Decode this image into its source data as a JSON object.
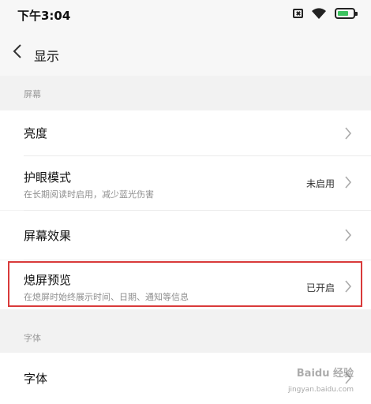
{
  "status_bar": {
    "time": "下午3:04",
    "icons": [
      "sim-off-icon",
      "wifi-icon",
      "battery-charging-icon"
    ],
    "battery_color": "#3cc35f"
  },
  "header": {
    "title": "显示",
    "back_icon": "chevron-left-icon"
  },
  "sections": {
    "screen": {
      "label": "屏幕",
      "items": [
        {
          "title": "亮度",
          "subtitle": "",
          "value": ""
        },
        {
          "title": "护眼模式",
          "subtitle": "在长期阅读时启用，减少蓝光伤害",
          "value": "未启用"
        },
        {
          "title": "屏幕效果",
          "subtitle": "",
          "value": ""
        },
        {
          "title": "熄屏预览",
          "subtitle": "在熄屏时始终展示时间、日期、通知等信息",
          "value": "已开启"
        }
      ]
    },
    "font": {
      "label": "字体",
      "items": [
        {
          "title": "字体",
          "subtitle": "",
          "value": ""
        }
      ]
    }
  },
  "highlight_color": "#d93a3a",
  "watermark": {
    "text": "Baidu 经验",
    "url": "jingyan.baidu.com"
  }
}
